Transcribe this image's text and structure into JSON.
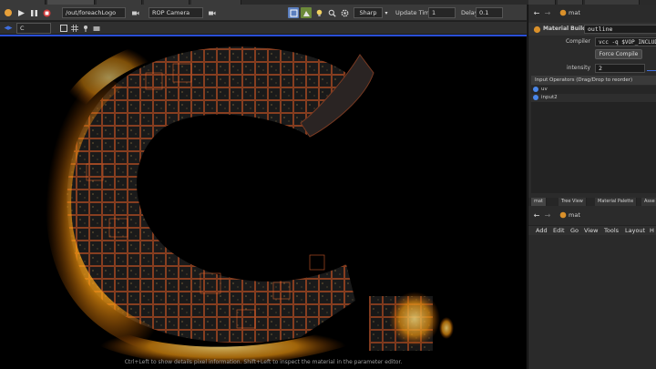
{
  "viewer_toolbar": {
    "path": "/out/foreachLogo",
    "camera": "ROP Camera",
    "render_quality": "Sharp",
    "update_time_label": "Update Time",
    "update_time_value": "1",
    "delay_label": "Delay",
    "delay_value": "0.1"
  },
  "viewer_toolbar2": {
    "channel": "C"
  },
  "viewport": {
    "hint_text": "Ctrl+Left to show details pixel information. Shift+Left to inspect the material in the parameter editor."
  },
  "right_panel": {
    "network_path": "mat",
    "node_type": "Material Builder",
    "node_name": "outline",
    "compiler_label": "Compiler",
    "compiler_value": "vcc -q $VOP_INCLUDEPATH",
    "force_compile_label": "Force Compile",
    "intensity_label": "intensity",
    "intensity_value": "2",
    "input_operators_header": "Input Operators (Drag/Drop to reorder)",
    "input_operators": [
      "uv",
      "input2"
    ],
    "lower_tabs": [
      "mat",
      "Tree View",
      "Material Palette",
      "Asse"
    ],
    "lower_network_path": "mat",
    "menu_items": [
      "Add",
      "Edit",
      "Go",
      "View",
      "Tools",
      "Layout",
      "H"
    ]
  },
  "colors": {
    "accent_blue": "#2a4fd6",
    "glow_orange": "#ffb020",
    "viewport_bg": "#000000"
  }
}
